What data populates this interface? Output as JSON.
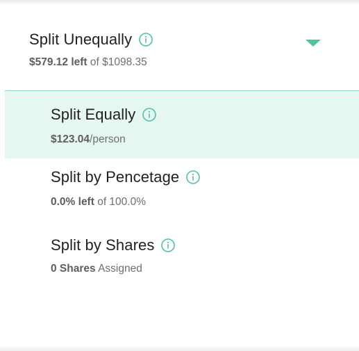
{
  "header": {
    "title": "Split Unequally",
    "remaining_amount": "$579.12 left",
    "remaining_suffix": " of $1098.35"
  },
  "options": [
    {
      "title": "Split Equally",
      "strong": "$123.04",
      "suffix": "/person",
      "selected": true
    },
    {
      "title": "Split by Pencetage",
      "strong": "0.0% left",
      "suffix": " of 100.0%",
      "selected": false
    },
    {
      "title": "Split by Shares",
      "strong": "0 Shares",
      "suffix": " Assigned",
      "selected": false
    }
  ],
  "colors": {
    "accent": "#4fc3a1",
    "selected_bg": "#e6f6f0",
    "divider": "#8fd9c3",
    "title_text": "#212121",
    "subtitle_text": "#6f6f6f"
  },
  "icons": {
    "info": "info-circle-icon",
    "dropdown": "caret-down-icon"
  }
}
